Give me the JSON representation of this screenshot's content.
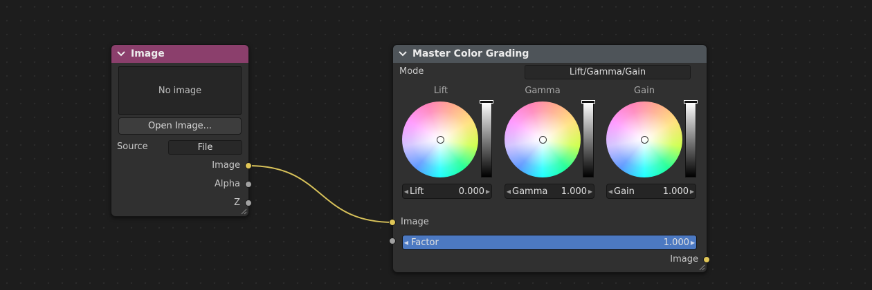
{
  "colors": {
    "image_header": "#8b3f6c",
    "grading_header": "#4e5459",
    "socket_image": "#e0c657",
    "socket_value": "#a1a1a1",
    "link": "#d8c25a",
    "factor_fill": "#4c79c2"
  },
  "image_node": {
    "title": "Image",
    "preview_text": "No image",
    "open_button": "Open Image...",
    "source_label": "Source",
    "source_value": "File",
    "outputs": [
      "Image",
      "Alpha",
      "Z"
    ]
  },
  "grading_node": {
    "title": "Master Color Grading",
    "mode_label": "Mode",
    "mode_value": "Lift/Gamma/Gain",
    "wheels": [
      {
        "label": "Lift",
        "field_label": "Lift",
        "value": "0.000",
        "level": 1.0
      },
      {
        "label": "Gamma",
        "field_label": "Gamma",
        "value": "1.000",
        "level": 1.0
      },
      {
        "label": "Gain",
        "field_label": "Gain",
        "value": "1.000",
        "level": 1.0
      }
    ],
    "input_image": "Image",
    "factor": {
      "label": "Factor",
      "value": "1.000",
      "fraction": 1.0
    },
    "output_image": "Image"
  },
  "icons": {
    "collapse": "chevron-down-icon",
    "resize": "resize-grip-icon",
    "arrow_left": "triangle-left-icon",
    "arrow_right": "triangle-right-icon"
  }
}
